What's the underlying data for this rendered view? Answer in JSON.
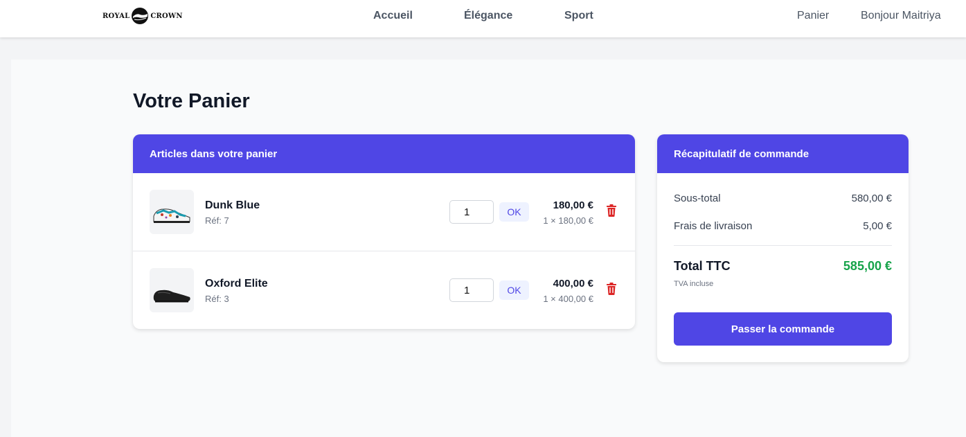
{
  "brand": {
    "left": "ROYAL",
    "right": "CROWN"
  },
  "nav": {
    "home": "Accueil",
    "elegance": "Élégance",
    "sport": "Sport",
    "cart": "Panier",
    "greeting": "Bonjour Maitriya"
  },
  "page": {
    "title": "Votre Panier"
  },
  "cart": {
    "header": "Articles dans votre panier",
    "items": [
      {
        "name": "Dunk Blue",
        "ref": "Réf: 7",
        "qty": "1",
        "ok": "OK",
        "price": "180,00 €",
        "detail": "1 × 180,00 €"
      },
      {
        "name": "Oxford Elite",
        "ref": "Réf: 3",
        "qty": "1",
        "ok": "OK",
        "price": "400,00 €",
        "detail": "1 × 400,00 €"
      }
    ]
  },
  "summary": {
    "header": "Récapitulatif de commande",
    "subtotal_label": "Sous-total",
    "subtotal": "580,00 €",
    "shipping_label": "Frais de livraison",
    "shipping": "5,00 €",
    "total_label": "Total TTC",
    "total": "585,00 €",
    "tva": "TVA incluse",
    "checkout": "Passer la commande"
  },
  "colors": {
    "accent": "#4f46e5",
    "total": "#16a34a",
    "danger": "#dc2626"
  },
  "icons": [
    "royal-crown-logo",
    "sneaker-image",
    "dress-shoe-image",
    "trash-icon"
  ]
}
